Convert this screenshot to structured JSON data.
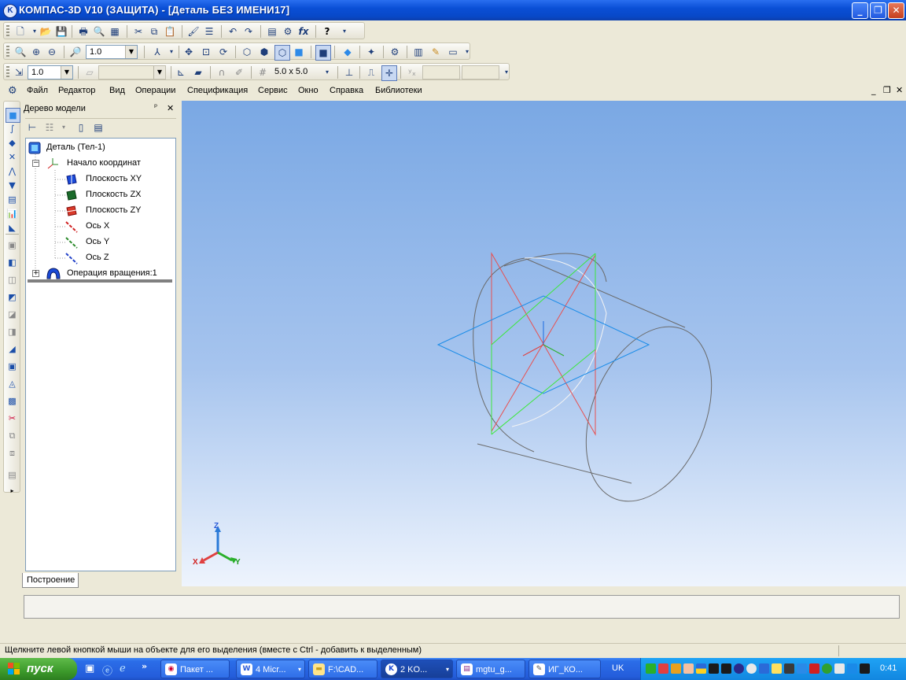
{
  "window": {
    "title": "КОМПАС-3D V10 (ЗАЩИТА) - [Деталь БЕЗ ИМЕНИ17]",
    "app_icon": "kompas-logo-icon"
  },
  "toolbars": {
    "view_scale": "1.0",
    "current_scale": "1.0",
    "grid_step": "5.0 x 5.0"
  },
  "menu": {
    "items": [
      "Файл",
      "Редактор",
      "Вид",
      "Операции",
      "Спецификация",
      "Сервис",
      "Окно",
      "Справка",
      "Библиотеки"
    ]
  },
  "tree": {
    "title": "Дерево модели",
    "pin_glyph": "ᵖ",
    "close_glyph": "✕",
    "nodes": [
      {
        "label": "Деталь (Тел-1)",
        "icon": "part-icon"
      },
      {
        "label": "Начало координат",
        "icon": "origin-icon"
      },
      {
        "label": "Плоскость XY",
        "icon": "plane-xy-icon"
      },
      {
        "label": "Плоскость ZX",
        "icon": "plane-zx-icon"
      },
      {
        "label": "Плоскость ZY",
        "icon": "plane-zy-icon"
      },
      {
        "label": "Ось X",
        "icon": "axis-x-icon"
      },
      {
        "label": "Ось Y",
        "icon": "axis-y-icon"
      },
      {
        "label": "Ось Z",
        "icon": "axis-z-icon"
      },
      {
        "label": "Операция вращения:1",
        "icon": "revolve-icon"
      }
    ],
    "tab": "Построение"
  },
  "viewport": {
    "triad": {
      "x": "X",
      "y": "Y",
      "z": "Z"
    },
    "colors": {
      "plane_xy": "#1a8ce8",
      "plane_zx": "#e85050",
      "plane_zy": "#3ce83c",
      "edge": "#6a6a6a"
    }
  },
  "status": {
    "text": "Щелкните левой кнопкой мыши на объекте для его выделения (вместе с Ctrl - добавить к выделенным)"
  },
  "taskbar": {
    "start_label": "пуск",
    "tasks": [
      {
        "label": "Пакет ..."
      },
      {
        "label": "4 Micr..."
      },
      {
        "label": "F:\\CAD..."
      },
      {
        "label": "2 KO..."
      },
      {
        "label": "mgtu_g..."
      },
      {
        "label": "ИГ_КО..."
      }
    ],
    "language": "UK",
    "clock": "0:41"
  }
}
